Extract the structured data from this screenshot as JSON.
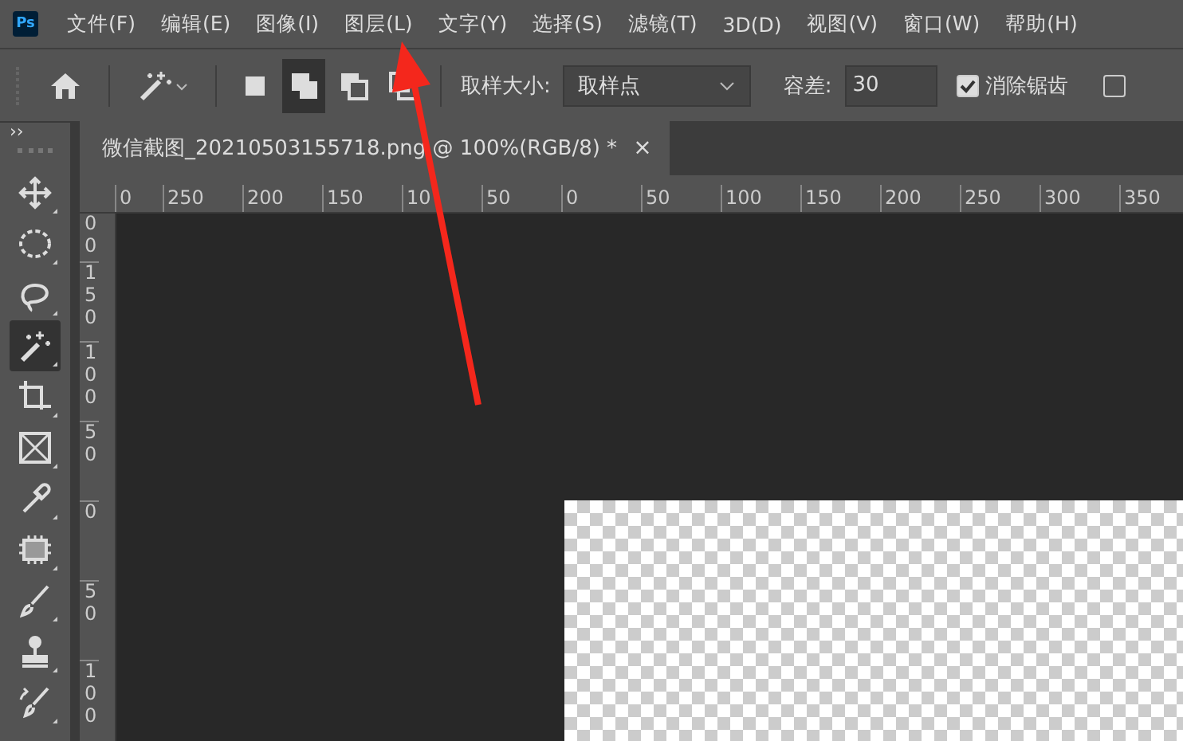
{
  "menu_bar": {
    "logo": "Ps",
    "items": [
      "文件(F)",
      "编辑(E)",
      "图像(I)",
      "图层(L)",
      "文字(Y)",
      "选择(S)",
      "滤镜(T)",
      "3D(D)",
      "视图(V)",
      "窗口(W)",
      "帮助(H)"
    ]
  },
  "options_bar": {
    "selection_modes": [
      {
        "kind": "new",
        "selected": false
      },
      {
        "kind": "add",
        "selected": true
      },
      {
        "kind": "subtract",
        "selected": false
      },
      {
        "kind": "intersect",
        "selected": false
      }
    ],
    "sample_size": {
      "label": "取样大小:",
      "value": "取样点"
    },
    "tolerance": {
      "label": "容差:",
      "value": "30"
    },
    "anti_alias": {
      "label": "消除锯齿",
      "checked": true
    },
    "checkbox_2": {
      "checked": false
    }
  },
  "panel_toggle": "››",
  "document_tab": {
    "title": "微信截图_20210503155718.png @ 100%(RGB/8) *",
    "close": "×"
  },
  "tools": [
    {
      "kind": "move",
      "selected": false
    },
    {
      "kind": "marquee",
      "selected": false
    },
    {
      "kind": "lasso",
      "selected": false
    },
    {
      "kind": "wand",
      "selected": true
    },
    {
      "kind": "crop",
      "selected": false
    },
    {
      "kind": "frame",
      "selected": false
    },
    {
      "kind": "eyedropper",
      "selected": false
    },
    {
      "kind": "patch",
      "selected": false
    },
    {
      "kind": "brush",
      "selected": false
    },
    {
      "kind": "stamp",
      "selected": false
    },
    {
      "kind": "history",
      "selected": false
    }
  ],
  "horizontal_ruler": [
    "0",
    "250",
    "200",
    "150",
    "10",
    "50",
    "0",
    "50",
    "100",
    "150",
    "200",
    "250",
    "300",
    "350"
  ],
  "vertical_ruler": [
    "00",
    "150",
    "100",
    "50",
    "0",
    "50",
    "100"
  ]
}
